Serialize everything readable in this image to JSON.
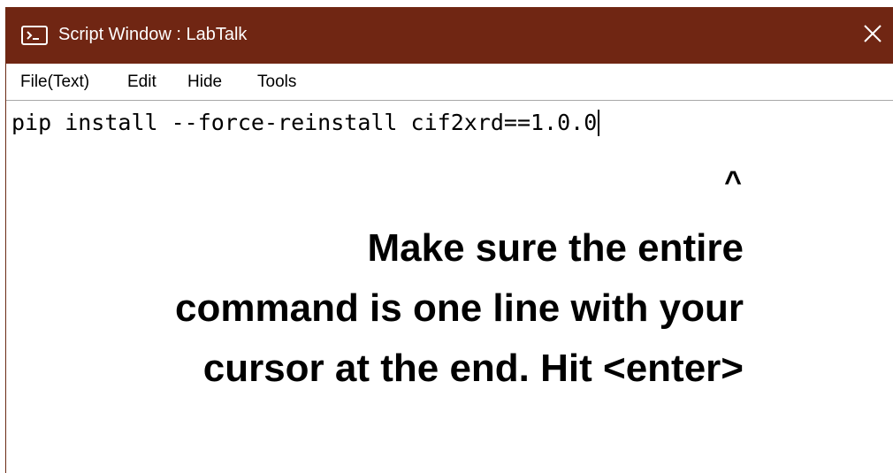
{
  "window": {
    "title": "Script Window : LabTalk",
    "title_icon": "terminal-icon",
    "close_icon": "close-icon",
    "titlebar_color": "#702613"
  },
  "menu": {
    "items": [
      {
        "label": "File(Text)"
      },
      {
        "label": "Edit"
      },
      {
        "label": "Hide"
      },
      {
        "label": "Tools"
      }
    ]
  },
  "editor": {
    "command": "pip install --force-reinstall cif2xrd==1.0.0"
  },
  "annotation": {
    "pointer": "^",
    "lines": [
      "Make sure the entire",
      "command is one line with your",
      "cursor at the end. Hit <enter>"
    ]
  }
}
